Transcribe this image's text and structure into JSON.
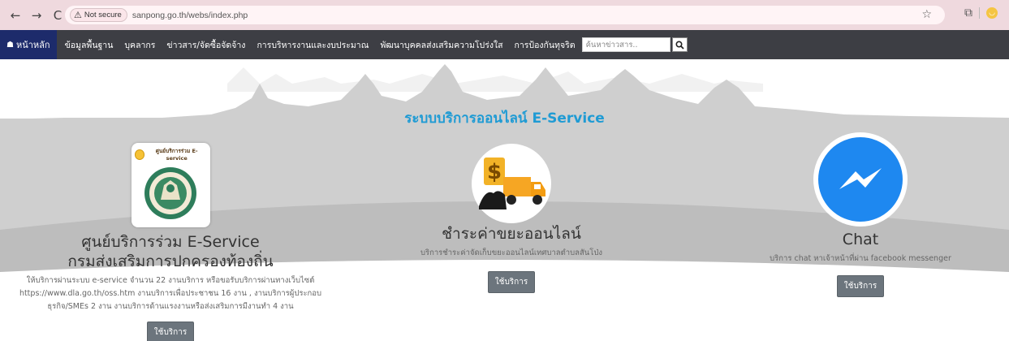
{
  "browser": {
    "security_label": "Not secure",
    "url": "sanpong.go.th/webs/index.php"
  },
  "navbar": {
    "home_label": "หน้าหลัก",
    "items": [
      {
        "label": "ข้อมูลพื้นฐาน"
      },
      {
        "label": "บุคลากร"
      },
      {
        "label": "ข่าวสาร/จัดซื้อจัดจ้าง"
      },
      {
        "label": "การบริหารงานและงบประมาณ"
      },
      {
        "label": "พัฒนาบุคคลส่งเสริมความโปร่งใส"
      },
      {
        "label": "การป้องกันทุจริต"
      }
    ],
    "search_placeholder": "ค้นหาข่าวสาร.."
  },
  "section": {
    "title": "ระบบบริการออนไลน์ E-Service"
  },
  "cards": [
    {
      "logo_text": "ศูนย์บริการร่วม E-service",
      "title_line1": "ศูนย์บริการร่วม E-Service",
      "title_line2": "กรมส่งเสริมการปกครองท้องถิ่น",
      "desc_line1": "ให้บริการผ่านระบบ e-service จำนวน 22 งานบริการ หรือขอรับบริการผ่านทางเว็บไซต์",
      "desc_line2": "https://www.dla.go.th/oss.htm งานบริการเพื่อประชาชน 16 งาน , งานบริการผู้ประกอบ",
      "desc_line3": "ธุรกิจ/SMEs 2 งาน งานบริการด้านแรงงานหรือส่งเสริมการมีงานทำ 4 งาน",
      "button": "ใช้บริการ"
    },
    {
      "title": "ชำระค่าขยะออนไลน์",
      "desc": "บริการชำระค่าจัดเก็บขยะออนไลน์เทศบาลตำบลสันโป่ง",
      "button": "ใช้บริการ"
    },
    {
      "title": "Chat",
      "desc": "บริการ chat หาเจ้าหน้าที่ผ่าน facebook messenger",
      "button": "ใช้บริการ"
    }
  ],
  "colors": {
    "navbar_bg": "#3d3e44",
    "home_bg": "#1d2b6b",
    "title_blue": "#1f9bd4",
    "messenger_blue": "#1e88f0",
    "button_gray": "#6c757d"
  }
}
